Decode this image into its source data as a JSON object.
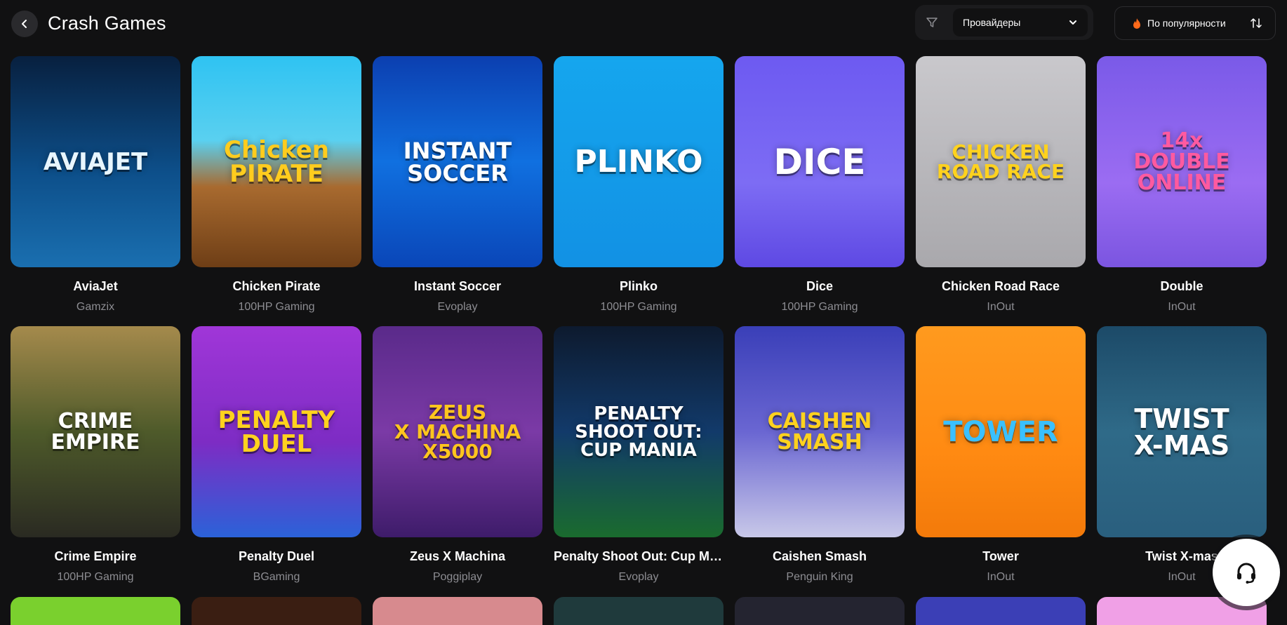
{
  "header": {
    "title": "Crash Games",
    "providers_label": "Провайдеры",
    "sort_label": "По популярности"
  },
  "games": [
    {
      "name": "AviaJet",
      "provider": "Gamzix",
      "art": "AVIAJET",
      "bg": "linear-gradient(180deg,#08203f 0%,#0d4f8a 55%,#1a6fb0 100%)",
      "fg": "#e8f6ff",
      "size": 34
    },
    {
      "name": "Chicken Pirate",
      "provider": "100HP Gaming",
      "art": "Chicken\nPIRATE",
      "bg": "linear-gradient(180deg,#2fc3f2 0%,#5ad0f0 40%,#a86a2f 62%,#6e3e16 100%)",
      "fg": "#ffcc1e",
      "size": 34
    },
    {
      "name": "Instant Soccer",
      "provider": "Evoplay",
      "art": "INSTANT\nSOCCER",
      "bg": "linear-gradient(180deg,#0c3fb0 0%,#1070e0 50%,#0a46b8 100%)",
      "fg": "#ffffff",
      "size": 32
    },
    {
      "name": "Plinko",
      "provider": "100HP Gaming",
      "art": "PLINKO",
      "bg": "linear-gradient(180deg,#15a6ee 0%,#1291e4 100%)",
      "fg": "#ffffff",
      "size": 44
    },
    {
      "name": "Dice",
      "provider": "100HP Gaming",
      "art": "DICE",
      "bg": "linear-gradient(180deg,#6d5af1 0%,#7d6cf4 60%,#5e49e3 100%)",
      "fg": "#ffffff",
      "size": 50
    },
    {
      "name": "Chicken Road Race",
      "provider": "InOut",
      "art": "CHICKEN\nROAD RACE",
      "bg": "linear-gradient(180deg,#c9c8cc 0%,#a9a8ac 100%)",
      "fg": "#ffd21e",
      "size": 28
    },
    {
      "name": "Double",
      "provider": "InOut",
      "art": "14x\nDOUBLE\nONLINE",
      "bg": "linear-gradient(180deg,#7a5ae8 0%,#9b6cf2 60%,#7b55e0 100%)",
      "fg": "#ff5aa0",
      "size": 30
    },
    {
      "name": "Crime Empire",
      "provider": "100HP Gaming",
      "art": "CRIME\nEMPIRE",
      "bg": "linear-gradient(180deg,#a58a4c 0%,#4e5a2a 50%,#2a2a22 100%)",
      "fg": "#ffffff",
      "size": 30
    },
    {
      "name": "Penalty Duel",
      "provider": "BGaming",
      "art": "PENALTY\nDUEL",
      "bg": "linear-gradient(180deg,#a036d8 0%,#7d2cc4 55%,#2b62d8 100%)",
      "fg": "#ffd21e",
      "size": 34
    },
    {
      "name": "Zeus X Machina",
      "provider": "Poggiplay",
      "art": "ZEUS\nX MACHINA\nX5000",
      "bg": "linear-gradient(180deg,#5a2a8a 0%,#7b3aa6 50%,#3e1c6a 100%)",
      "fg": "#ffc51e",
      "size": 28
    },
    {
      "name": "Penalty Shoot Out: Cup Mania",
      "provider": "Evoplay",
      "art": "PENALTY\nSHOOT OUT:\nCUP MANIA",
      "bg": "linear-gradient(180deg,#0d1a2e 0%,#123a6a 50%,#1a6b2e 100%)",
      "fg": "#ffffff",
      "size": 26
    },
    {
      "name": "Caishen Smash",
      "provider": "Penguin King",
      "art": "CAISHEN\nSMASH",
      "bg": "linear-gradient(180deg,#3a3fb8 0%,#6a66d2 50%,#c8c8e8 100%)",
      "fg": "#ffd21e",
      "size": 30
    },
    {
      "name": "Tower",
      "provider": "InOut",
      "art": "TOWER",
      "bg": "linear-gradient(180deg,#ff9a1e 0%,#ff8a12 60%,#f37a0a 100%)",
      "fg": "#3ac0ff",
      "size": 40
    },
    {
      "name": "Twist X-mas",
      "provider": "InOut",
      "art": "TWIST\nX-MAS",
      "bg": "linear-gradient(180deg,#1c4a68 0%,#2f6a88 50%,#2a5f7e 100%)",
      "fg": "#ffffff",
      "size": 38
    }
  ],
  "partial_row": [
    "#7ad02e",
    "#3a1e12",
    "#d78a8e",
    "#1f3a3c",
    "#242430",
    "#3b3fb6",
    "#f0a0e6"
  ]
}
